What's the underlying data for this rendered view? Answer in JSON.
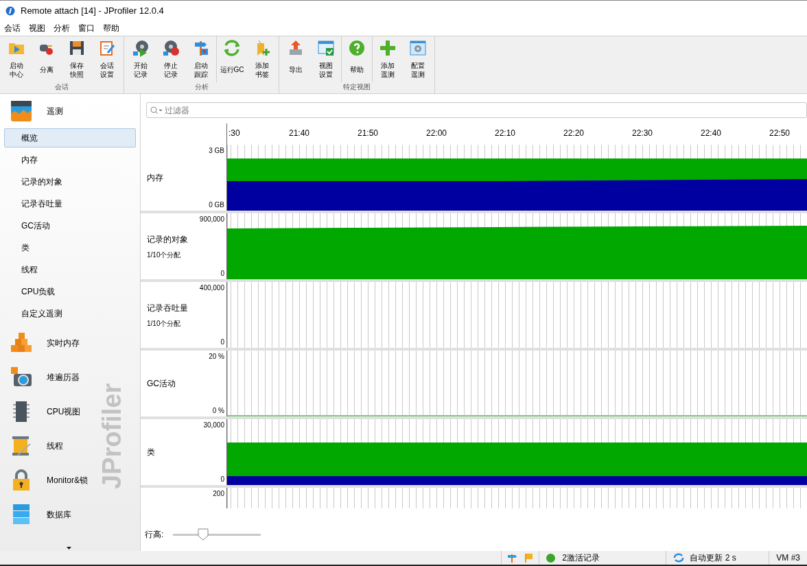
{
  "window": {
    "title": "Remote attach [14] - JProfiler 12.0.4"
  },
  "menu": [
    "会话",
    "视图",
    "分析",
    "窗口",
    "帮助"
  ],
  "toolbar": {
    "groups": [
      {
        "label": "会话",
        "sections": [
          [
            [
              "启动",
              "中心"
            ],
            [
              "分离"
            ],
            [
              "保存",
              "快照"
            ],
            [
              "会话",
              "设置"
            ]
          ]
        ]
      },
      {
        "label": "分析",
        "sections": [
          [
            [
              "开始",
              "记录"
            ],
            [
              "停止",
              "记录"
            ],
            [
              "启动",
              "跟踪"
            ]
          ],
          [
            [
              "运行GC"
            ],
            [
              "添加",
              "书签"
            ]
          ]
        ]
      },
      {
        "label": "特定视图",
        "sections": [
          [
            [
              "导出"
            ],
            [
              "视图",
              "设置"
            ]
          ],
          [
            [
              "帮助"
            ]
          ],
          [
            [
              "添加",
              "遥测"
            ],
            [
              "配置",
              "遥测"
            ]
          ]
        ]
      }
    ]
  },
  "sidebar": {
    "brand": "JProfiler",
    "sections": [
      {
        "label": "遥测",
        "items": [
          {
            "label": "概览",
            "selected": true
          },
          {
            "label": "内存",
            "selected": false
          },
          {
            "label": "记录的对象",
            "selected": false
          },
          {
            "label": "记录吞吐量",
            "selected": false
          },
          {
            "label": "GC活动",
            "selected": false
          },
          {
            "label": "类",
            "selected": false
          },
          {
            "label": "线程",
            "selected": false
          },
          {
            "label": "CPU负载",
            "selected": false
          },
          {
            "label": "自定义遥测",
            "selected": false
          }
        ]
      },
      {
        "label": "实时内存"
      },
      {
        "label": "堆遍历器"
      },
      {
        "label": "CPU视图"
      },
      {
        "label": "线程"
      },
      {
        "label": "Monitor&锁"
      },
      {
        "label": "数据库"
      }
    ]
  },
  "filter": {
    "placeholder": "过滤器"
  },
  "time_axis": [
    ":30",
    "21:40",
    "21:50",
    "22:00",
    "22:10",
    "22:20",
    "22:30",
    "22:40",
    "22:50"
  ],
  "telemetry_rows": [
    {
      "kind": "memory",
      "label": "内存",
      "top_tick": "3 GB",
      "bottom_tick": "0 GB"
    },
    {
      "kind": "single",
      "label": "记录的对象",
      "sublabel": "1/10个分配",
      "top_tick": "900,000",
      "bottom_tick": "0"
    },
    {
      "kind": "empty",
      "label": "记录吞吐量",
      "sublabel": "1/10个分配",
      "top_tick": "400,000",
      "bottom_tick": "0"
    },
    {
      "kind": "baseline",
      "label": "GC活动",
      "top_tick": "20 %",
      "bottom_tick": "0 %"
    },
    {
      "kind": "classes",
      "label": "类",
      "top_tick": "30,000",
      "bottom_tick": "0"
    },
    {
      "kind": "partial",
      "top_tick": "200"
    }
  ],
  "row_height": {
    "label": "行高:",
    "level": 0.34
  },
  "status_bar": {
    "recordings": {
      "text": "2激活记录",
      "color": "#3aa52a"
    },
    "update": "自动更新 2 s",
    "vm": "VM #3"
  }
}
